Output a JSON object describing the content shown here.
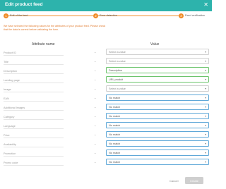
{
  "dialog": {
    "title": "Edit product feed",
    "close_icon": "close-icon"
  },
  "stepper": {
    "steps": [
      {
        "number": "1",
        "label": "Edit of the feed"
      },
      {
        "number": "2",
        "label": "Error detection"
      },
      {
        "number": "3",
        "label": "Feed verification"
      }
    ],
    "accent_color": "#f08c28"
  },
  "notice": "We have selected the following values for the attributes of your product feed. Please check that the data is correct before validating the form.",
  "columns": {
    "attribute": "Attribute name",
    "value": "Value"
  },
  "rows": [
    {
      "attribute": "Product ID",
      "value": "Select a value",
      "state": "empty"
    },
    {
      "attribute": "Title",
      "value": "Select a value",
      "state": "empty"
    },
    {
      "attribute": "Description",
      "value": "Description",
      "state": "matched"
    },
    {
      "attribute": "Landing page",
      "value": "URL produit",
      "state": "matched"
    },
    {
      "attribute": "Image",
      "value": "Select a value",
      "state": "empty"
    },
    {
      "attribute": "EAN",
      "value": "No match",
      "state": "nomatch"
    },
    {
      "attribute": "Additional Images",
      "value": "No match",
      "state": "nomatch"
    },
    {
      "attribute": "Category",
      "value": "No match",
      "state": "nomatch"
    },
    {
      "attribute": "Language",
      "value": "No match",
      "state": "nomatch"
    },
    {
      "attribute": "Price",
      "value": "No match",
      "state": "nomatch"
    },
    {
      "attribute": "Availability",
      "value": "No match",
      "state": "nomatch"
    },
    {
      "attribute": "Promotion",
      "value": "No match",
      "state": "nomatch"
    },
    {
      "attribute": "Promo code",
      "value": "No match",
      "state": "nomatch"
    }
  ],
  "footer": {
    "cancel_label": "Cancel",
    "create_label": "Create"
  },
  "colors": {
    "header": "#2db3ac",
    "matched_border": "#6cc46c",
    "nomatch_border": "#5fa8d8",
    "notice_text": "#e07a2e"
  }
}
